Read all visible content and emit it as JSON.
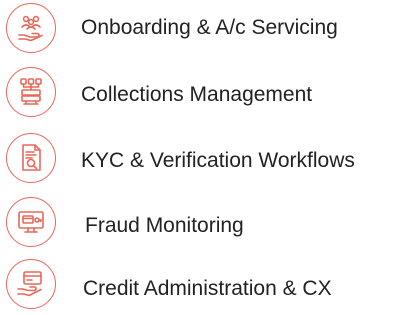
{
  "theme": {
    "accent": "#e8685a",
    "text": "#222222"
  },
  "items": [
    {
      "icon": "onboarding-icon",
      "label": "Onboarding & A/c Servicing"
    },
    {
      "icon": "collections-icon",
      "label": "Collections Management"
    },
    {
      "icon": "kyc-document-icon",
      "label": "KYC & Verification Workflows"
    },
    {
      "icon": "fraud-monitor-icon",
      "label": "Fraud Monitoring"
    },
    {
      "icon": "credit-card-hand-icon",
      "label": "Credit Administration & CX"
    }
  ]
}
